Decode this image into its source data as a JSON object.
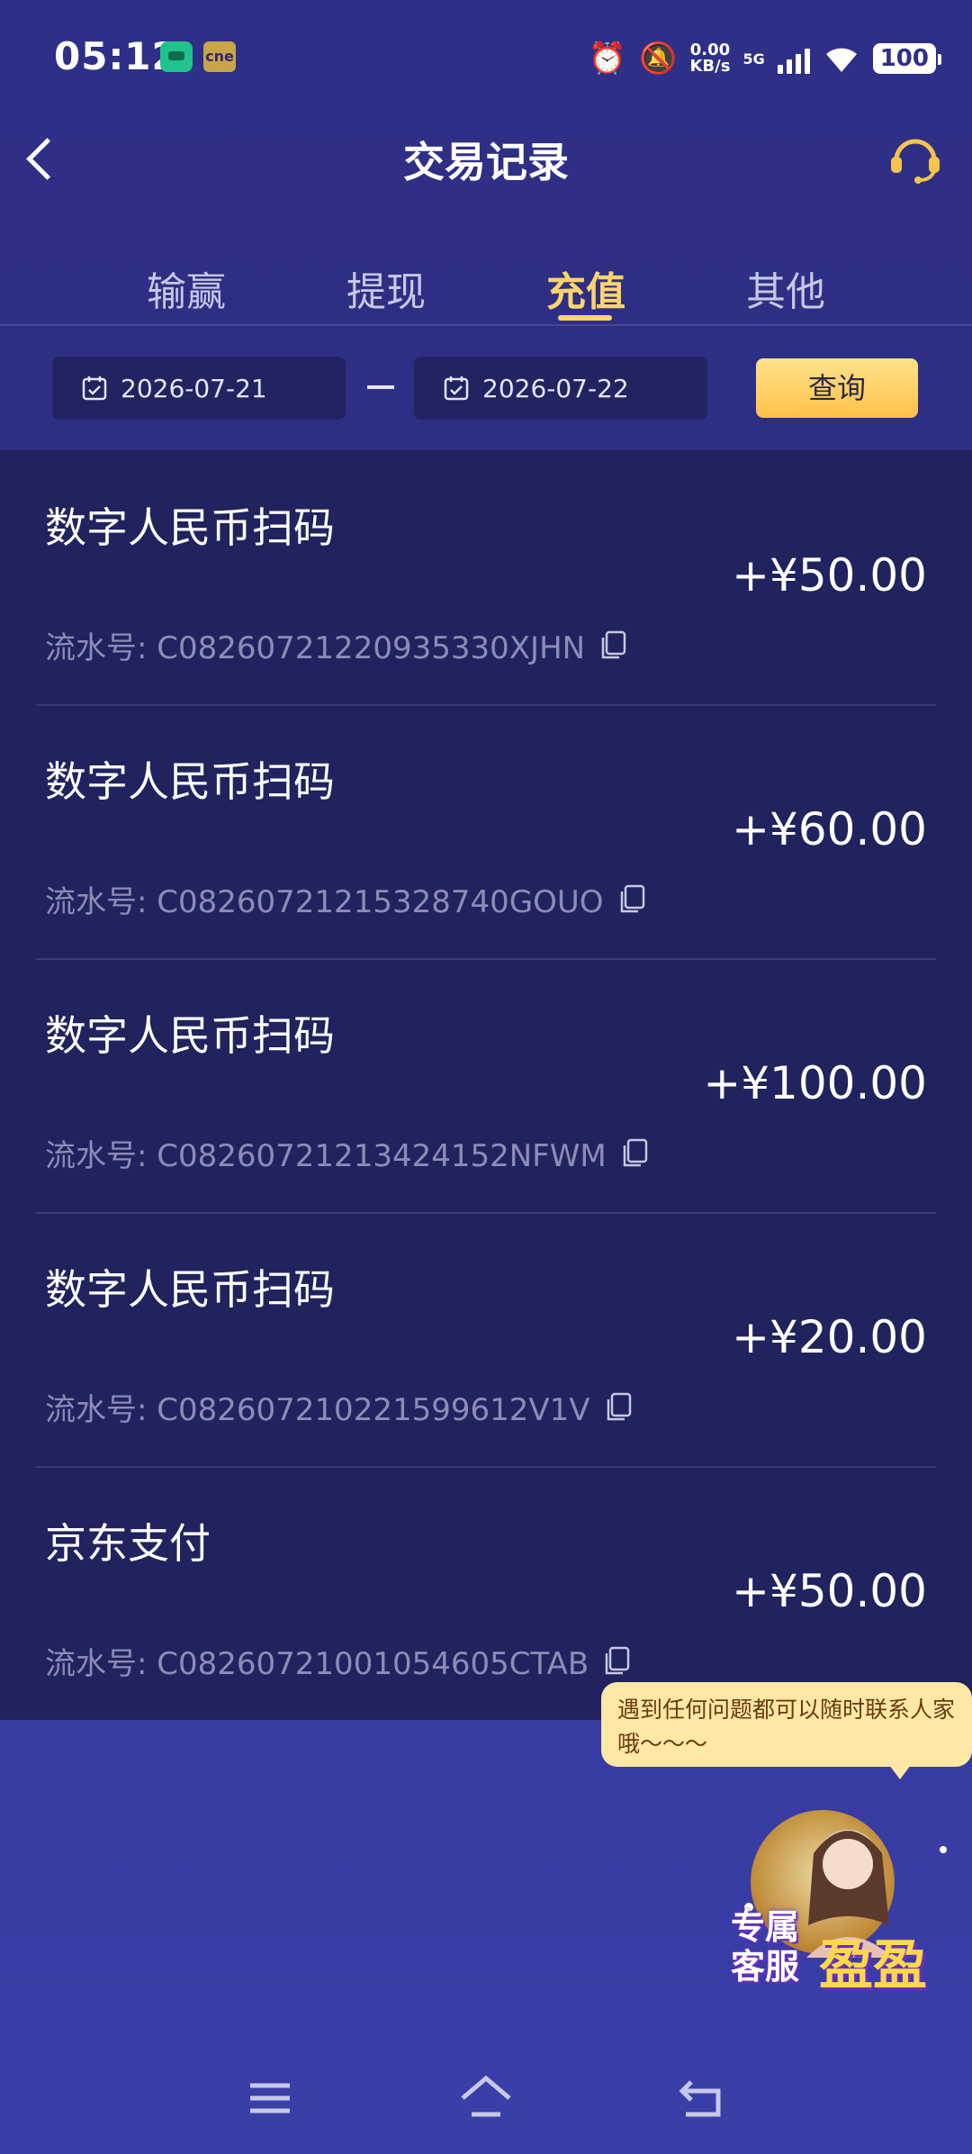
{
  "status_bar": {
    "time": "05:12",
    "app_badge": "cne",
    "speed_value": "0.00",
    "speed_unit": "KB/s",
    "network": "5G",
    "battery": "100"
  },
  "header": {
    "title": "交易记录"
  },
  "tabs": [
    {
      "label": "输赢",
      "active": false
    },
    {
      "label": "提现",
      "active": false
    },
    {
      "label": "充值",
      "active": true
    },
    {
      "label": "其他",
      "active": false
    }
  ],
  "filter": {
    "start_date": "2026-07-21",
    "end_date": "2026-07-22",
    "query_label": "查询"
  },
  "transactions": [
    {
      "name": "数字人民币扫码",
      "amount": "+¥50.00",
      "serial": "流水号: C08260721220935330XJHN"
    },
    {
      "name": "数字人民币扫码",
      "amount": "+¥60.00",
      "serial": "流水号: C08260721215328740GOUO"
    },
    {
      "name": "数字人民币扫码",
      "amount": "+¥100.00",
      "serial": "流水号: C08260721213424152NFWM"
    },
    {
      "name": "数字人民币扫码",
      "amount": "+¥20.00",
      "serial": "流水号: C082607210221599612V1V"
    },
    {
      "name": "京东支付",
      "amount": "+¥50.00",
      "serial": "流水号: C08260721001054605CTAB"
    }
  ],
  "support": {
    "bubble_text": "遇到任何问题都可以随时联系人家哦～～～",
    "promo_line1": "专属",
    "promo_line2": "客服",
    "promo_name": "盈盈"
  },
  "colors": {
    "accent": "#ffd56b",
    "background": "#2e2f86",
    "list_bg": "#21235f"
  }
}
